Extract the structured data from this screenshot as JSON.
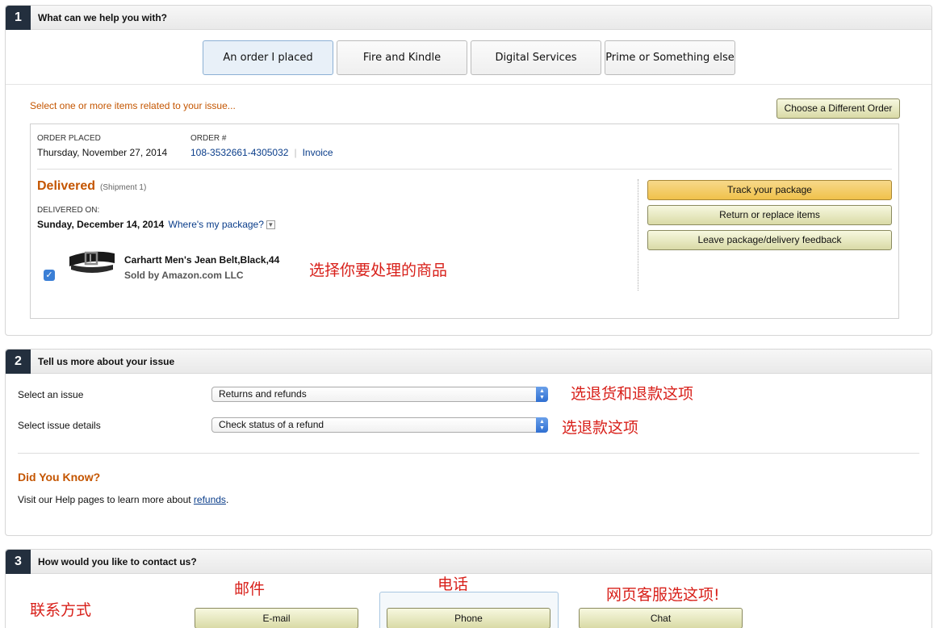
{
  "step1": {
    "number": "1",
    "title": "What can we help you with?",
    "tabs": [
      {
        "label": "An order I placed",
        "active": true
      },
      {
        "label": "Fire and Kindle",
        "active": false
      },
      {
        "label": "Digital Services",
        "active": false
      },
      {
        "label": "Prime or Something else",
        "active": false
      }
    ],
    "select_note": "Select one or more items related to your issue...",
    "choose_button": "Choose a Different Order",
    "order": {
      "placed_label": "ORDER PLACED",
      "placed_value": "Thursday, November 27, 2014",
      "number_label": "ORDER #",
      "number_value": "108-3532661-4305032",
      "separator": "|",
      "invoice_link": "Invoice",
      "status": "Delivered",
      "shipment": "(Shipment 1)",
      "delivered_on_label": "DELIVERED ON:",
      "delivered_on_value": "Sunday, December 14, 2014",
      "where_link": "Where's my package?",
      "item_name": "Carhartt Men's Jean Belt,Black,44",
      "item_seller": "Sold by Amazon.com LLC",
      "item_checked": true
    },
    "actions": {
      "track": "Track your package",
      "return": "Return or replace items",
      "feedback": "Leave package/delivery feedback"
    },
    "annotation": "选择你要处理的商品"
  },
  "step2": {
    "number": "2",
    "title": "Tell us more about your issue",
    "issue_label": "Select an issue",
    "issue_value": "Returns and refunds",
    "details_label": "Select issue details",
    "details_value": "Check status of a refund",
    "annotation_issue": "选退货和退款这项",
    "annotation_details": "选退款这项",
    "did_you_know": "Did You Know?",
    "visit_prefix": "Visit our Help pages to learn more about ",
    "visit_link": "refunds",
    "visit_suffix": "."
  },
  "step3": {
    "number": "3",
    "title": "How would you like to contact us?",
    "email": "E-mail",
    "phone": "Phone",
    "chat": "Chat",
    "annotation_method": "联系方式",
    "annotation_email": "邮件",
    "annotation_phone": "电话",
    "annotation_chat": "网页客服选这项!"
  },
  "colors": {
    "accent_orange": "#c45500",
    "link_blue": "#0a3d8a",
    "annotation_red": "#d8201a",
    "step_badge": "#232f3e"
  }
}
